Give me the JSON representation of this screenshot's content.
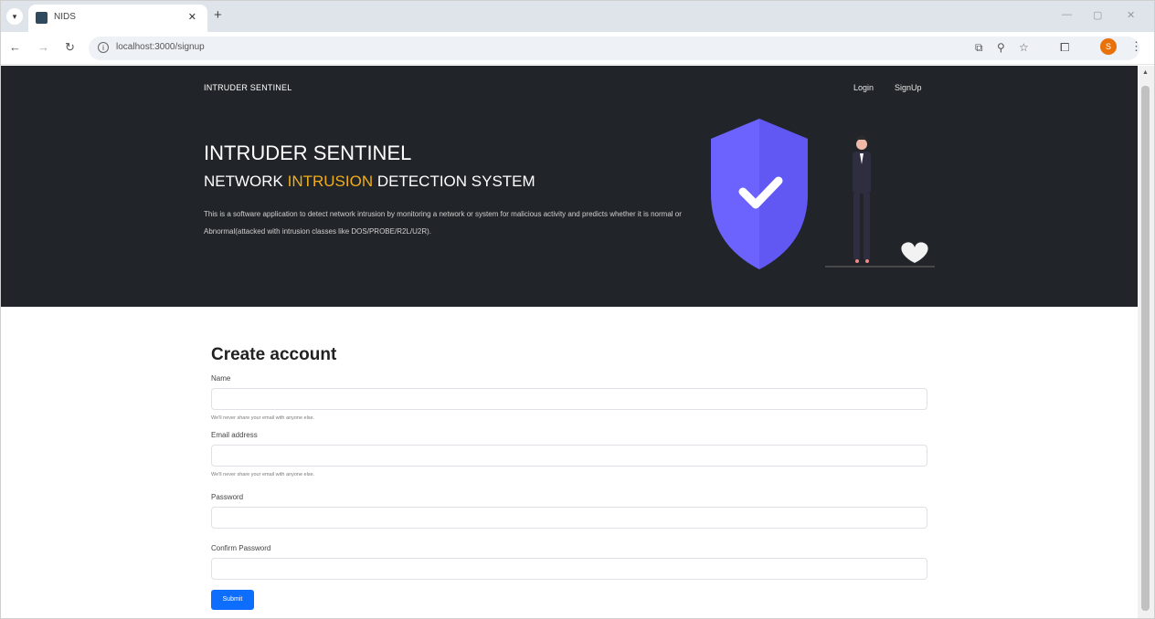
{
  "browser": {
    "tab_title": "NIDS",
    "url": "localhost:3000/signup",
    "profile_initial": "S"
  },
  "nav": {
    "brand": "INTRUDER SENTINEL",
    "links": [
      "Login",
      "SignUp"
    ]
  },
  "hero": {
    "title": "INTRUDER SENTINEL",
    "subtitle_pre": "NETWORK ",
    "subtitle_highlight": "INTRUSION",
    "subtitle_post": " DETECTION SYSTEM",
    "description": "This is a software application to detect network intrusion by monitoring a network or system for malicious activity and predicts whether it is normal or Abnormal(attacked with intrusion classes like DOS/PROBE/R2L/U2R).",
    "highlight_color": "#f0ad1c",
    "shield_color": "#6c63ff"
  },
  "form": {
    "title": "Create account",
    "fields": [
      {
        "label": "Name",
        "help": "We'll never share your email with anyone else."
      },
      {
        "label": "Email address",
        "help": "We'll never share your email with anyone else."
      },
      {
        "label": "Password"
      },
      {
        "label": "Confirm Password"
      }
    ],
    "submit_label": "Submit",
    "submit_color": "#0d6efd"
  },
  "icons": [
    "tab-search-icon",
    "favicon",
    "close-icon",
    "new-tab-icon",
    "minimize-icon",
    "maximize-icon",
    "window-close-icon",
    "back-icon",
    "forward-icon",
    "reload-icon",
    "site-info-icon",
    "cast-icon",
    "zoom-icon",
    "bookmark-star-icon",
    "extensions-icon",
    "menu-kebab-icon",
    "shield-check-icon"
  ]
}
